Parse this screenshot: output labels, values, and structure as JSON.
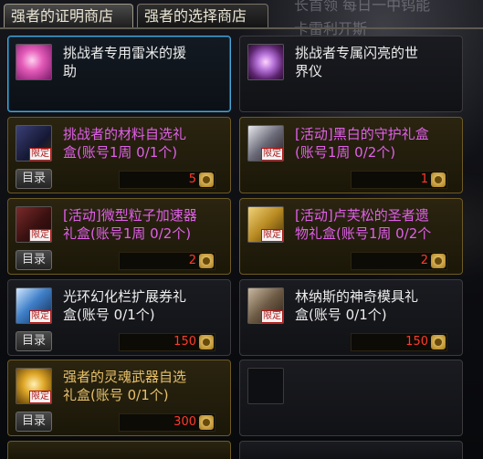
{
  "tabs": [
    {
      "label": "强者的证明商店",
      "active": true
    },
    {
      "label": "强者的选择商店",
      "active": false
    }
  ],
  "background_text": {
    "line1": "长首领 每日一中钨能",
    "line2": "卡雷利开斯"
  },
  "badge_label": "限定",
  "catalog_label": "目录",
  "items": [
    {
      "name": "挑战者专用雷米的援\n助",
      "color": "white"
    },
    {
      "name": "挑战者专属闪亮的世\n界仪",
      "color": "white"
    },
    {
      "name": "挑战者的材料自选礼\n盒(账号1周 0/1个)",
      "color": "pink",
      "price": "5",
      "badge": true
    },
    {
      "name": "[活动]黑白的守护礼盒\n(账号1周 0/2个)",
      "color": "pink",
      "price": "1",
      "badge": true
    },
    {
      "name": "[活动]微型粒子加速器\n礼盒(账号1周 0/2个)",
      "color": "pink",
      "price": "2",
      "badge": true
    },
    {
      "name": "[活动]卢芙松的圣者遗\n物礼盒(账号1周 0/2个",
      "color": "pink",
      "price": "2",
      "badge": true
    },
    {
      "name": "光环幻化栏扩展券礼\n盒(账号 0/1个)",
      "color": "white",
      "price": "150",
      "badge": true
    },
    {
      "name": "林纳斯的神奇模具礼\n盒(账号 0/1个)",
      "color": "white",
      "price": "150",
      "badge": true
    },
    {
      "name": "强者的灵魂武器自选\n礼盒(账号 0/1个)",
      "color": "gold",
      "price": "300",
      "badge": true
    }
  ],
  "colors": {
    "price": "#ff3a2a",
    "pink_name": "#e060e8",
    "gold_name": "#e6c06a",
    "selected_border": "#4aa8d8"
  }
}
